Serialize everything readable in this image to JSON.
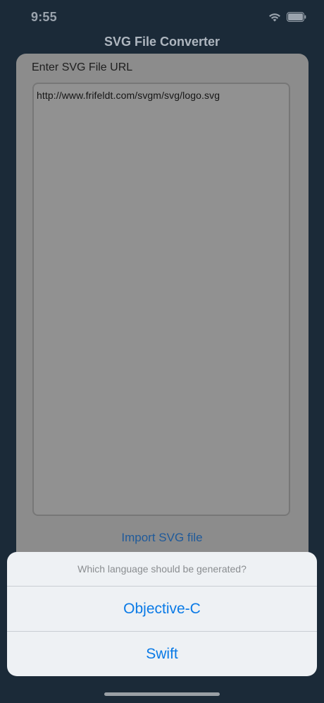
{
  "status_bar": {
    "time": "9:55",
    "wifi_icon": "wifi-icon",
    "battery_icon": "battery-icon"
  },
  "nav": {
    "title": "SVG File Converter"
  },
  "form": {
    "label": "Enter SVG File URL",
    "url_value": "http://www.frifeldt.com/svgm/svg/logo.svg",
    "import_button": "Import SVG file"
  },
  "action_sheet": {
    "message": "Which language should be generated?",
    "options": [
      "Objective-C",
      "Swift"
    ]
  },
  "colors": {
    "background": "#1b2a38",
    "accent": "#0a7ae6",
    "card": "#8c8c8c"
  }
}
